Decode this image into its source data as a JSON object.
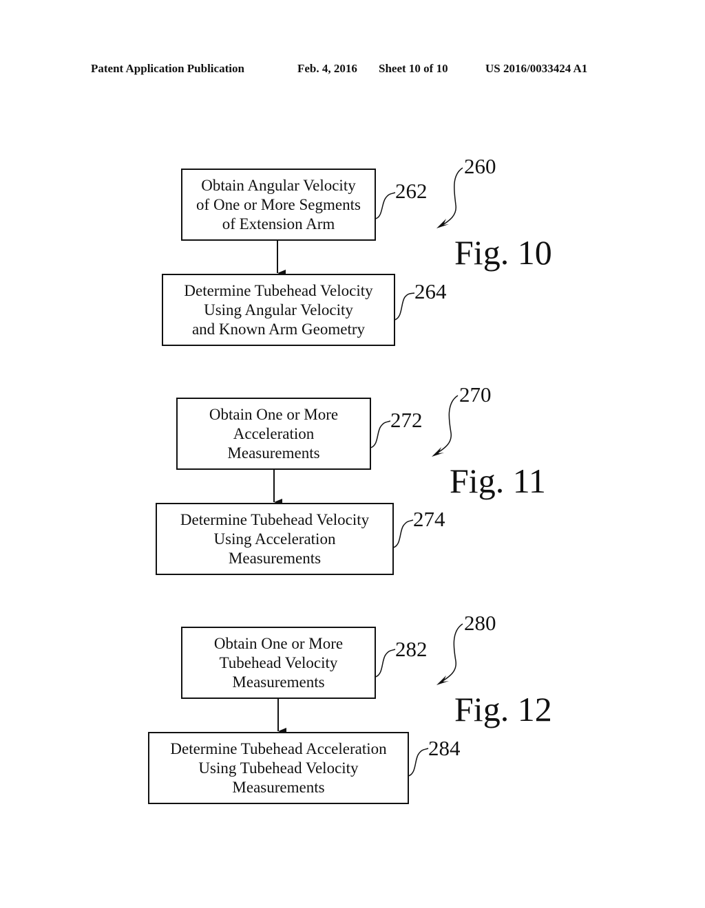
{
  "header": {
    "left": "Patent Application Publication",
    "date": "Feb. 4, 2016",
    "sheet": "Sheet 10 of 10",
    "number": "US 2016/0033424 A1"
  },
  "figures": [
    {
      "label": "Fig. 10",
      "ref": "260",
      "steps": [
        {
          "ref": "262",
          "lines": [
            "Obtain Angular Velocity",
            "of One or More Segments",
            "of Extension Arm"
          ]
        },
        {
          "ref": "264",
          "lines": [
            "Determine Tubehead Velocity",
            "Using Angular Velocity",
            "and Known Arm Geometry"
          ]
        }
      ]
    },
    {
      "label": "Fig. 11",
      "ref": "270",
      "steps": [
        {
          "ref": "272",
          "lines": [
            "Obtain One or More",
            "Acceleration",
            "Measurements"
          ]
        },
        {
          "ref": "274",
          "lines": [
            "Determine Tubehead Velocity",
            "Using Acceleration",
            "Measurements"
          ]
        }
      ]
    },
    {
      "label": "Fig. 12",
      "ref": "280",
      "steps": [
        {
          "ref": "282",
          "lines": [
            "Obtain One or More",
            "Tubehead Velocity",
            "Measurements"
          ]
        },
        {
          "ref": "284",
          "lines": [
            "Determine Tubehead Acceleration",
            "Using Tubehead Velocity",
            "Measurements"
          ]
        }
      ]
    }
  ]
}
